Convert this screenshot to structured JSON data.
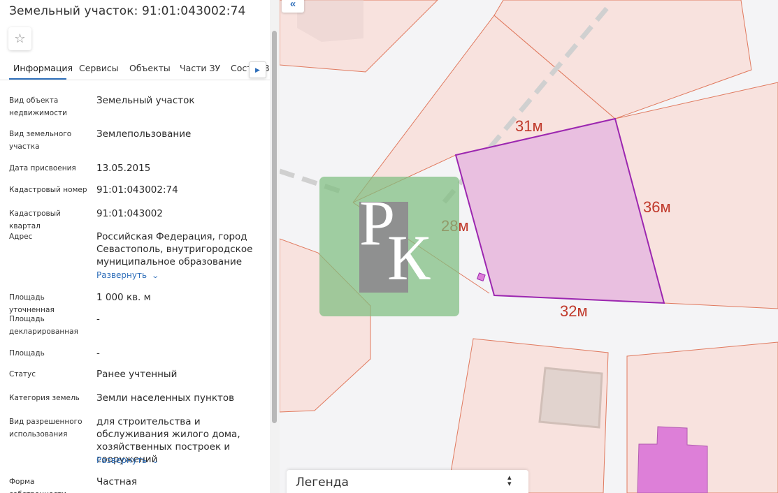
{
  "panel": {
    "title": "Земельный участок: 91:01:043002:74",
    "favorite_icon": "star-icon",
    "tabs": [
      "Информация",
      "Сервисы",
      "Объекты",
      "Части ЗУ",
      "Сост",
      "В"
    ],
    "active_tab": "Информация",
    "tab_scroll_icon": "chevron-right-icon",
    "expand_label": "Развернуть",
    "rows": [
      {
        "label": "Вид объекта недвижимости",
        "value": "Земельный участок"
      },
      {
        "label": "Вид земельного участка",
        "value": "Землепользование"
      },
      {
        "label": "Дата присвоения",
        "value": "13.05.2015"
      },
      {
        "label": "Кадастровый номер",
        "value": "91:01:043002:74"
      },
      {
        "label": "Кадастровый квартал",
        "value": "91:01:043002"
      },
      {
        "label": "Адрес",
        "value": "Российская Федерация, город Севастополь, внутригородское муниципальное образование"
      },
      {
        "label": "Площадь уточненная",
        "value": "1 000 кв. м"
      },
      {
        "label": "Площадь декларированная",
        "value": "-"
      },
      {
        "label": "Площадь",
        "value": "-"
      },
      {
        "label": "Статус",
        "value": "Ранее учтенный"
      },
      {
        "label": "Категория земель",
        "value": "Земли населенных пунктов"
      },
      {
        "label": "Вид разрешенного использования",
        "value": "для строительства и обслуживания жилого дома, хозяйственных построек и сооружений"
      },
      {
        "label": "Форма собственности",
        "value": "Частная"
      }
    ]
  },
  "map": {
    "collapse_icon": "double-chevron-left-icon",
    "dimensions": [
      "31м",
      "36м",
      "28м",
      "32м"
    ],
    "watermark_letters": [
      "Р",
      "К"
    ],
    "legend_label": "Легенда",
    "legend_toggle_icon": "expand-collapse-icon",
    "colors": {
      "parcel_fill": "#f8e2de",
      "parcel_border": "#e07a5f",
      "selected_fill": "#e9bfe0",
      "selected_border": "#9c27b0",
      "building_fill": "#dd7fd8",
      "dimension_text": "#c0392b",
      "accent": "#2f6fba"
    }
  }
}
